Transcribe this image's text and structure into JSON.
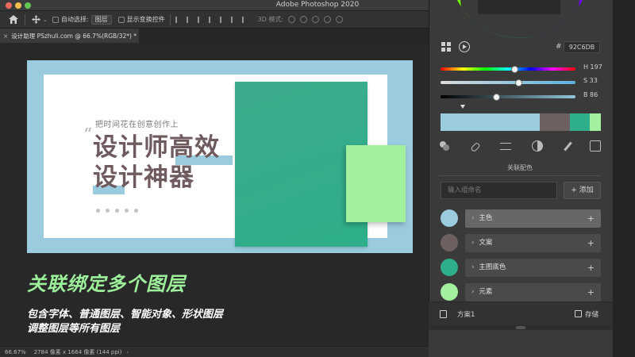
{
  "window": {
    "title": "Adobe Photoshop 2020"
  },
  "options_bar": {
    "auto_select_label": "自动选择:",
    "auto_select_value": "图层",
    "show_transform_label": "显示变换控件",
    "mode_3d_label": "3D 模式:"
  },
  "document_tab": {
    "title": "设计助理 PSzhuli.com @ 66.7%(RGB/32*) *"
  },
  "artwork": {
    "tagline": "把时间花在创意创作上",
    "quote": "“",
    "headline_1": "设计师高效",
    "headline_2": "设计神器",
    "colors": {
      "background": "#9ACBDF",
      "headline": "#6F5A5E",
      "main": "#2EAE8A",
      "accent": "#A3F09F"
    }
  },
  "promo": {
    "title": "关联绑定多个图层",
    "line_1": "包含字体、普通图层、智能对象、形状图层",
    "line_2": "调整图层等所有图层"
  },
  "status_bar": {
    "zoom": "66.67%",
    "doc_info": "2784 像素 x 1664 像素 (144 ppi)",
    "chevron": "›"
  },
  "color_panel": {
    "hash": "#",
    "hex_value": "92C6DB",
    "hue_label": "H 197",
    "sat_label": "S 33",
    "bri_label": "B 86",
    "hue": 197,
    "saturation": 33,
    "brightness": 86,
    "palette": [
      {
        "color": "#9ACBDF",
        "weight": 125
      },
      {
        "color": "#6E5F60",
        "weight": 38
      },
      {
        "color": "#2EAE8A",
        "weight": 25
      },
      {
        "color": "#A3F09F",
        "weight": 14
      }
    ]
  },
  "linked_colors": {
    "title": "关联配色",
    "input_placeholder": "输入组命名",
    "add_label": "+ 添加",
    "groups": [
      {
        "name": "主色",
        "color": "#9ACBDF",
        "active": true
      },
      {
        "name": "文案",
        "color": "#6E5F60",
        "active": false
      },
      {
        "name": "主图底色",
        "color": "#2EAE8A",
        "active": false
      },
      {
        "name": "元素",
        "color": "#A3F09F",
        "active": false
      }
    ],
    "caret": "›",
    "plus": "+"
  },
  "footer": {
    "scheme_label": "方案1",
    "save_label": "存储"
  },
  "icons": [
    "home-icon",
    "move-icon",
    "grid-icon",
    "play-icon",
    "blend-icon",
    "link-icon",
    "adjust-icon",
    "contrast-icon",
    "eyedropper-icon",
    "image-icon",
    "scheme-icon",
    "save-icon"
  ]
}
